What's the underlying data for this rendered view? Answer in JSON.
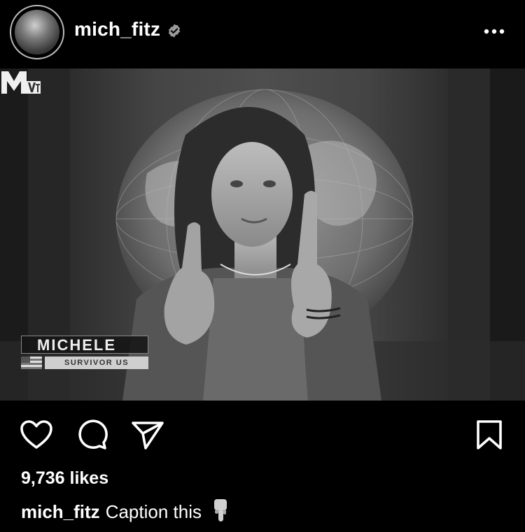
{
  "header": {
    "username": "mich_fitz",
    "verified": true,
    "more_icon": "more-horizontal-icon"
  },
  "media": {
    "lower_third_name": "MICHELE",
    "lower_third_subtitle": "SURVIVOR US",
    "network_logo_text": "MTV"
  },
  "actions": {
    "like_icon": "heart-icon",
    "comment_icon": "comment-icon",
    "share_icon": "send-icon",
    "save_icon": "bookmark-icon"
  },
  "likes_text": "9,736 likes",
  "caption": {
    "username": "mich_fitz",
    "text": "Caption this",
    "emoji": "pointing-down-hand-icon"
  }
}
